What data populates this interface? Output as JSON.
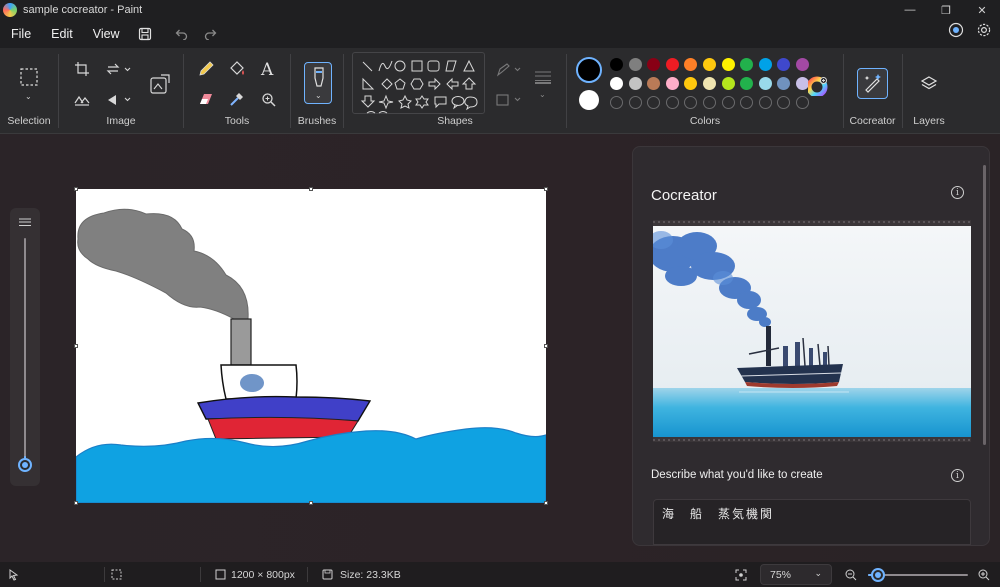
{
  "window": {
    "title": "sample cocreator - Paint"
  },
  "menu": {
    "file": "File",
    "edit": "Edit",
    "view": "View"
  },
  "ribbon": {
    "selection_label": "Selection",
    "image_label": "Image",
    "tools_label": "Tools",
    "brushes_label": "Brushes",
    "shapes_label": "Shapes",
    "colors_label": "Colors",
    "cocreator_label": "Cocreator",
    "layers_label": "Layers"
  },
  "colors": {
    "primary": "#000000",
    "secondary": "#ffffff",
    "row1": [
      "#000000",
      "#7f7f7f",
      "#880015",
      "#ed1c24",
      "#ff7f27",
      "#ffc90e",
      "#fff200",
      "#22b14c",
      "#00a2e8",
      "#3f48cc",
      "#a349a4"
    ],
    "row2": [
      "#ffffff",
      "#c3c3c3",
      "#b97a57",
      "#ffaec9",
      "#ffc90e",
      "#efe4b0",
      "#b5e61d",
      "#22b14c",
      "#99d9ea",
      "#7092be",
      "#c8bfe7"
    ]
  },
  "cocreator": {
    "title": "Cocreator",
    "describe_label": "Describe what you'd like to create",
    "prompt_value": "海　船　蒸気機関"
  },
  "status": {
    "canvas_size": "1200 × 800px",
    "file_size": "Size: 23.3KB",
    "zoom": "75%"
  }
}
